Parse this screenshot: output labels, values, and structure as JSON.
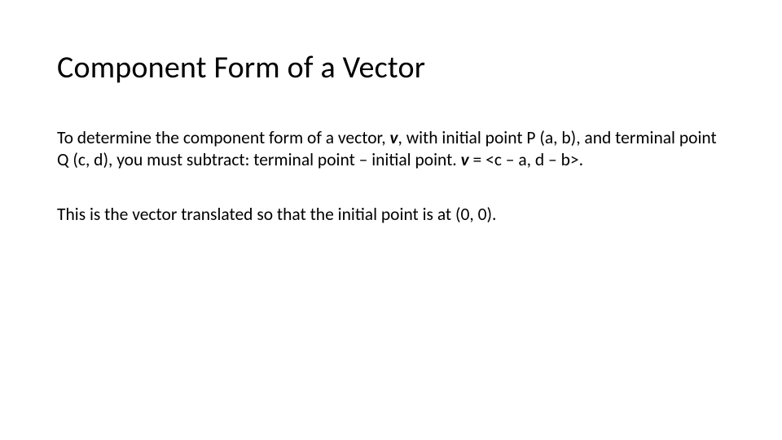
{
  "title": "Component Form of a Vector",
  "paragraph1": {
    "part1": "To determine the component form of a vector, ",
    "v1": "v",
    "part2": ", with initial point P (a, b), and terminal point Q (c, d), you must subtract: terminal point – initial point.  ",
    "v2": "v",
    "part3": " = <c – a, d – b>."
  },
  "paragraph2": "This is the vector translated so that the initial point is at (0, 0)."
}
